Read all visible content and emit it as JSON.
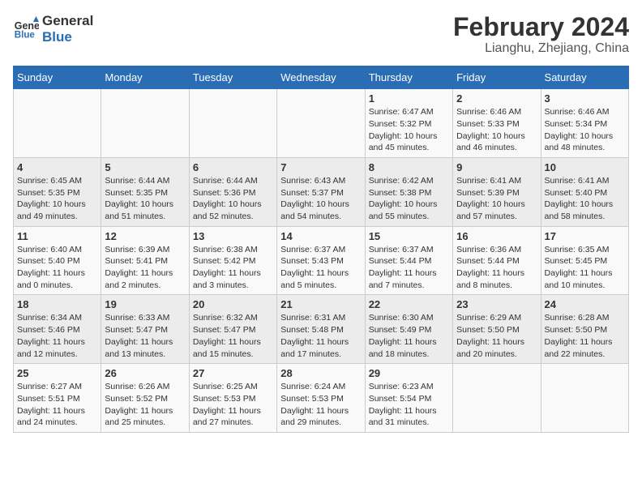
{
  "header": {
    "logo_line1": "General",
    "logo_line2": "Blue",
    "main_title": "February 2024",
    "subtitle": "Lianghu, Zhejiang, China"
  },
  "weekdays": [
    "Sunday",
    "Monday",
    "Tuesday",
    "Wednesday",
    "Thursday",
    "Friday",
    "Saturday"
  ],
  "weeks": [
    [
      {
        "day": "",
        "sunrise": "",
        "sunset": "",
        "daylight": ""
      },
      {
        "day": "",
        "sunrise": "",
        "sunset": "",
        "daylight": ""
      },
      {
        "day": "",
        "sunrise": "",
        "sunset": "",
        "daylight": ""
      },
      {
        "day": "",
        "sunrise": "",
        "sunset": "",
        "daylight": ""
      },
      {
        "day": "1",
        "sunrise": "Sunrise: 6:47 AM",
        "sunset": "Sunset: 5:32 PM",
        "daylight": "Daylight: 10 hours and 45 minutes."
      },
      {
        "day": "2",
        "sunrise": "Sunrise: 6:46 AM",
        "sunset": "Sunset: 5:33 PM",
        "daylight": "Daylight: 10 hours and 46 minutes."
      },
      {
        "day": "3",
        "sunrise": "Sunrise: 6:46 AM",
        "sunset": "Sunset: 5:34 PM",
        "daylight": "Daylight: 10 hours and 48 minutes."
      }
    ],
    [
      {
        "day": "4",
        "sunrise": "Sunrise: 6:45 AM",
        "sunset": "Sunset: 5:35 PM",
        "daylight": "Daylight: 10 hours and 49 minutes."
      },
      {
        "day": "5",
        "sunrise": "Sunrise: 6:44 AM",
        "sunset": "Sunset: 5:35 PM",
        "daylight": "Daylight: 10 hours and 51 minutes."
      },
      {
        "day": "6",
        "sunrise": "Sunrise: 6:44 AM",
        "sunset": "Sunset: 5:36 PM",
        "daylight": "Daylight: 10 hours and 52 minutes."
      },
      {
        "day": "7",
        "sunrise": "Sunrise: 6:43 AM",
        "sunset": "Sunset: 5:37 PM",
        "daylight": "Daylight: 10 hours and 54 minutes."
      },
      {
        "day": "8",
        "sunrise": "Sunrise: 6:42 AM",
        "sunset": "Sunset: 5:38 PM",
        "daylight": "Daylight: 10 hours and 55 minutes."
      },
      {
        "day": "9",
        "sunrise": "Sunrise: 6:41 AM",
        "sunset": "Sunset: 5:39 PM",
        "daylight": "Daylight: 10 hours and 57 minutes."
      },
      {
        "day": "10",
        "sunrise": "Sunrise: 6:41 AM",
        "sunset": "Sunset: 5:40 PM",
        "daylight": "Daylight: 10 hours and 58 minutes."
      }
    ],
    [
      {
        "day": "11",
        "sunrise": "Sunrise: 6:40 AM",
        "sunset": "Sunset: 5:40 PM",
        "daylight": "Daylight: 11 hours and 0 minutes."
      },
      {
        "day": "12",
        "sunrise": "Sunrise: 6:39 AM",
        "sunset": "Sunset: 5:41 PM",
        "daylight": "Daylight: 11 hours and 2 minutes."
      },
      {
        "day": "13",
        "sunrise": "Sunrise: 6:38 AM",
        "sunset": "Sunset: 5:42 PM",
        "daylight": "Daylight: 11 hours and 3 minutes."
      },
      {
        "day": "14",
        "sunrise": "Sunrise: 6:37 AM",
        "sunset": "Sunset: 5:43 PM",
        "daylight": "Daylight: 11 hours and 5 minutes."
      },
      {
        "day": "15",
        "sunrise": "Sunrise: 6:37 AM",
        "sunset": "Sunset: 5:44 PM",
        "daylight": "Daylight: 11 hours and 7 minutes."
      },
      {
        "day": "16",
        "sunrise": "Sunrise: 6:36 AM",
        "sunset": "Sunset: 5:44 PM",
        "daylight": "Daylight: 11 hours and 8 minutes."
      },
      {
        "day": "17",
        "sunrise": "Sunrise: 6:35 AM",
        "sunset": "Sunset: 5:45 PM",
        "daylight": "Daylight: 11 hours and 10 minutes."
      }
    ],
    [
      {
        "day": "18",
        "sunrise": "Sunrise: 6:34 AM",
        "sunset": "Sunset: 5:46 PM",
        "daylight": "Daylight: 11 hours and 12 minutes."
      },
      {
        "day": "19",
        "sunrise": "Sunrise: 6:33 AM",
        "sunset": "Sunset: 5:47 PM",
        "daylight": "Daylight: 11 hours and 13 minutes."
      },
      {
        "day": "20",
        "sunrise": "Sunrise: 6:32 AM",
        "sunset": "Sunset: 5:47 PM",
        "daylight": "Daylight: 11 hours and 15 minutes."
      },
      {
        "day": "21",
        "sunrise": "Sunrise: 6:31 AM",
        "sunset": "Sunset: 5:48 PM",
        "daylight": "Daylight: 11 hours and 17 minutes."
      },
      {
        "day": "22",
        "sunrise": "Sunrise: 6:30 AM",
        "sunset": "Sunset: 5:49 PM",
        "daylight": "Daylight: 11 hours and 18 minutes."
      },
      {
        "day": "23",
        "sunrise": "Sunrise: 6:29 AM",
        "sunset": "Sunset: 5:50 PM",
        "daylight": "Daylight: 11 hours and 20 minutes."
      },
      {
        "day": "24",
        "sunrise": "Sunrise: 6:28 AM",
        "sunset": "Sunset: 5:50 PM",
        "daylight": "Daylight: 11 hours and 22 minutes."
      }
    ],
    [
      {
        "day": "25",
        "sunrise": "Sunrise: 6:27 AM",
        "sunset": "Sunset: 5:51 PM",
        "daylight": "Daylight: 11 hours and 24 minutes."
      },
      {
        "day": "26",
        "sunrise": "Sunrise: 6:26 AM",
        "sunset": "Sunset: 5:52 PM",
        "daylight": "Daylight: 11 hours and 25 minutes."
      },
      {
        "day": "27",
        "sunrise": "Sunrise: 6:25 AM",
        "sunset": "Sunset: 5:53 PM",
        "daylight": "Daylight: 11 hours and 27 minutes."
      },
      {
        "day": "28",
        "sunrise": "Sunrise: 6:24 AM",
        "sunset": "Sunset: 5:53 PM",
        "daylight": "Daylight: 11 hours and 29 minutes."
      },
      {
        "day": "29",
        "sunrise": "Sunrise: 6:23 AM",
        "sunset": "Sunset: 5:54 PM",
        "daylight": "Daylight: 11 hours and 31 minutes."
      },
      {
        "day": "",
        "sunrise": "",
        "sunset": "",
        "daylight": ""
      },
      {
        "day": "",
        "sunrise": "",
        "sunset": "",
        "daylight": ""
      }
    ]
  ]
}
